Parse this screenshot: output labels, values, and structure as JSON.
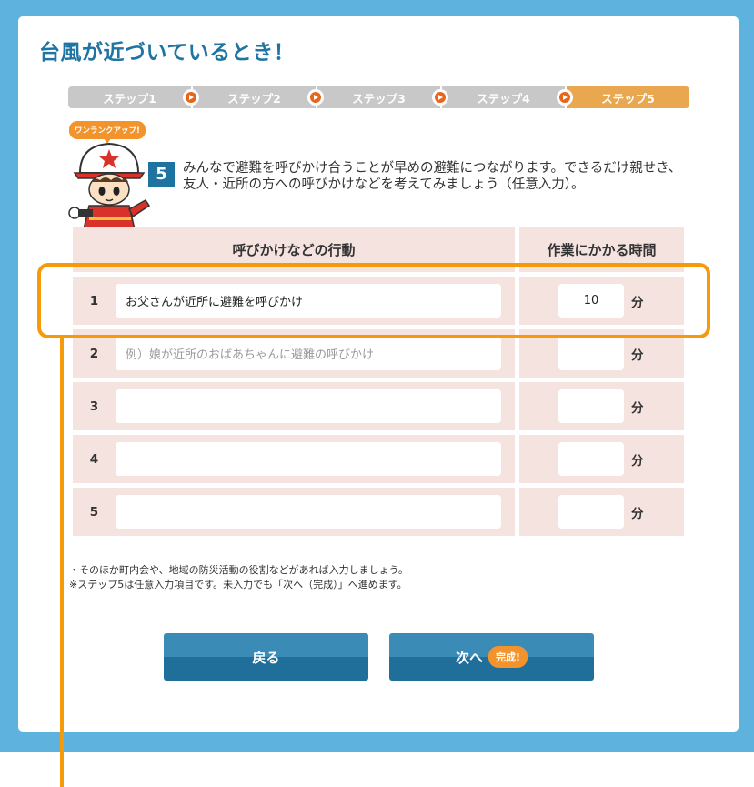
{
  "page": {
    "title": "台風が近づいているとき！"
  },
  "steps": [
    {
      "label": "ステップ1",
      "active": false
    },
    {
      "label": "ステップ2",
      "active": false
    },
    {
      "label": "ステップ3",
      "active": false
    },
    {
      "label": "ステップ4",
      "active": false
    },
    {
      "label": "ステップ5",
      "active": true
    }
  ],
  "mascot": {
    "badge": "ワンランクアップ!"
  },
  "section": {
    "number": "5",
    "text": "みんなで避難を呼びかけ合うことが早めの避難につながります。できるだけ親せき、友人・近所の方への呼びかけなどを考えてみましょう（任意入力）。"
  },
  "table": {
    "headers": {
      "action": "呼びかけなどの行動",
      "time": "作業にかかる時間"
    },
    "unit": "分",
    "rows": [
      {
        "num": "1",
        "value": "お父さんが近所に避難を呼びかけ",
        "placeholder": "",
        "minutes": "10"
      },
      {
        "num": "2",
        "value": "",
        "placeholder": "例）娘が近所のおばあちゃんに避難の呼びかけ",
        "minutes": ""
      },
      {
        "num": "3",
        "value": "",
        "placeholder": "",
        "minutes": ""
      },
      {
        "num": "4",
        "value": "",
        "placeholder": "",
        "minutes": ""
      },
      {
        "num": "5",
        "value": "",
        "placeholder": "",
        "minutes": ""
      }
    ]
  },
  "notes": [
    "・そのほか町内会や、地域の防災活動の役割などがあれば入力しましょう。",
    "※ステップ5は任意入力項目です。未入力でも「次へ（完成）」へ進めます。"
  ],
  "buttons": {
    "back": "戻る",
    "next": "次へ",
    "next_badge": "完成!"
  },
  "colors": {
    "accent": "#1f74a3",
    "step_active": "#e9a84f",
    "highlight": "#f59a0b",
    "row_bg": "#f5e3df"
  }
}
